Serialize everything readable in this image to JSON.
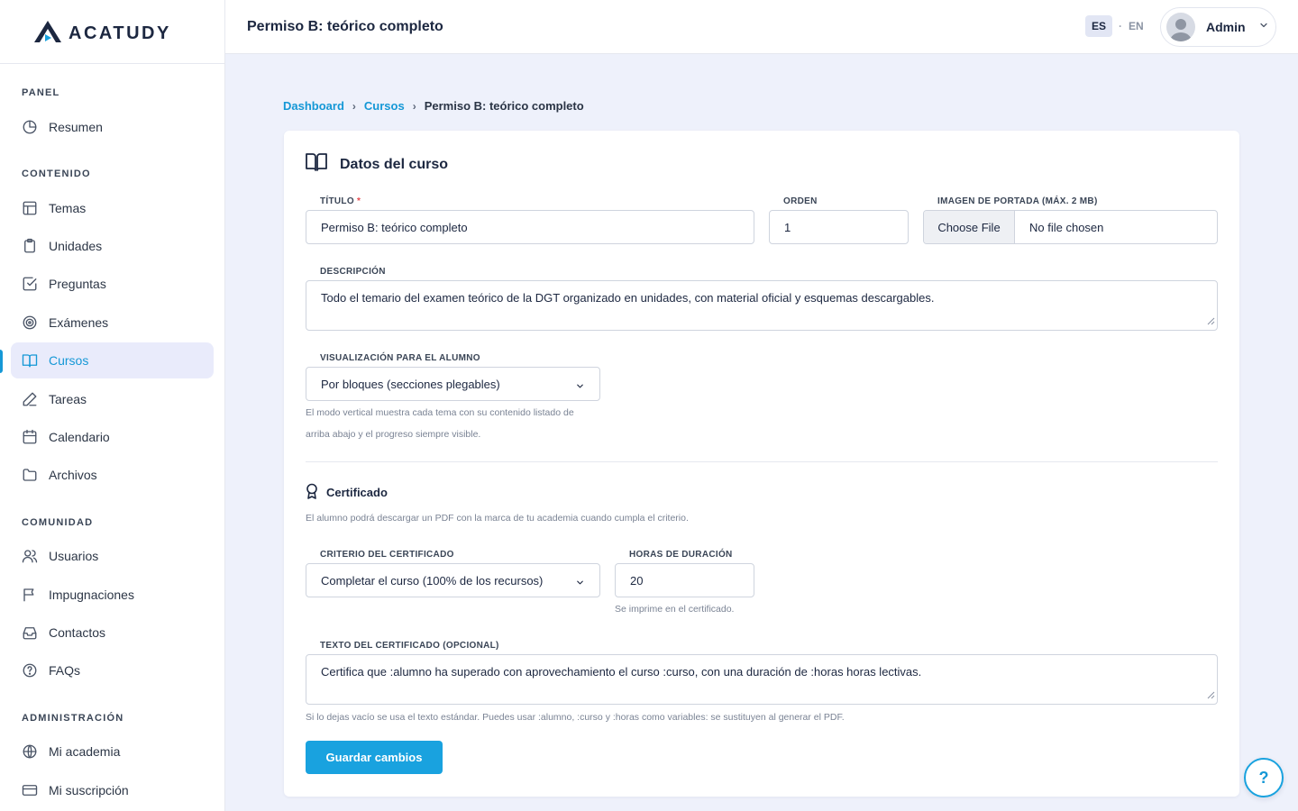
{
  "brand": {
    "name": "ACATUDY"
  },
  "sidebar": {
    "sections": [
      {
        "title": "PANEL"
      },
      {
        "title": "CONTENIDO"
      },
      {
        "title": "COMUNIDAD"
      },
      {
        "title": "ADMINISTRACIÓN"
      }
    ],
    "items": [
      {
        "label": "Resumen",
        "icon": "chart-pie-icon"
      },
      {
        "label": "Temas",
        "icon": "layout-icon"
      },
      {
        "label": "Unidades",
        "icon": "clipboard-icon"
      },
      {
        "label": "Preguntas",
        "icon": "checkbox-icon"
      },
      {
        "label": "Exámenes",
        "icon": "target-icon"
      },
      {
        "label": "Cursos",
        "icon": "book-open-icon",
        "active": true
      },
      {
        "label": "Tareas",
        "icon": "pencil-icon"
      },
      {
        "label": "Calendario",
        "icon": "calendar-icon"
      },
      {
        "label": "Archivos",
        "icon": "folder-icon"
      },
      {
        "label": "Usuarios",
        "icon": "users-icon"
      },
      {
        "label": "Impugnaciones",
        "icon": "flag-icon"
      },
      {
        "label": "Contactos",
        "icon": "inbox-icon"
      },
      {
        "label": "FAQs",
        "icon": "help-circle-icon"
      },
      {
        "label": "Mi academia",
        "icon": "globe-icon"
      },
      {
        "label": "Mi suscripción",
        "icon": "credit-card-icon"
      }
    ]
  },
  "header": {
    "title": "Permiso B: teórico completo",
    "lang": {
      "es": "ES",
      "separator": "·",
      "en": "EN"
    },
    "user": {
      "name": "Admin"
    }
  },
  "breadcrumb": {
    "items": [
      "Dashboard",
      "Cursos",
      "Permiso B: teórico completo"
    ],
    "separator": "›"
  },
  "form": {
    "title": "Datos del curso",
    "titulo": {
      "label": "TÍTULO",
      "required_mark": "*",
      "value": "Permiso B: teórico completo"
    },
    "orden": {
      "label": "ORDEN",
      "value": "1"
    },
    "imagen": {
      "label": "IMAGEN DE PORTADA (MÁX. 2 MB)",
      "button": "Choose File",
      "status": "No file chosen"
    },
    "descripcion": {
      "label": "DESCRIPCIÓN",
      "value": "Todo el temario del examen teórico de la DGT organizado en unidades, con material oficial y esquemas descargables."
    },
    "visualizacion": {
      "label": "VISUALIZACIÓN PARA EL ALUMNO",
      "value": "Por bloques (secciones plegables)",
      "help_line1": "El modo vertical muestra cada tema con su contenido listado de",
      "help_line2": "arriba abajo y el progreso siempre visible."
    },
    "certificado": {
      "title": "Certificado",
      "description": "El alumno podrá descargar un PDF con la marca de tu academia cuando cumpla el criterio.",
      "criterio": {
        "label": "CRITERIO DEL CERTIFICADO",
        "value": "Completar el curso (100% de los recursos)"
      },
      "horas": {
        "label": "HORAS DE DURACIÓN",
        "value": "20",
        "help": "Se imprime en el certificado."
      },
      "texto": {
        "label": "TEXTO DEL CERTIFICADO (OPCIONAL)",
        "value": "Certifica que :alumno ha superado con aprovechamiento el curso :curso, con una duración de :horas horas lectivas.",
        "help": "Si lo dejas vacío se usa el texto estándar. Puedes usar :alumno, :curso y :horas como variables: se sustituyen al generar el PDF."
      }
    },
    "save_label": "Guardar cambios"
  },
  "help_button": {
    "label": "?"
  },
  "colors": {
    "accent": "#19a2df",
    "link": "#1598d6",
    "active_bg": "#e9ebfb",
    "required": "#e5484d"
  }
}
